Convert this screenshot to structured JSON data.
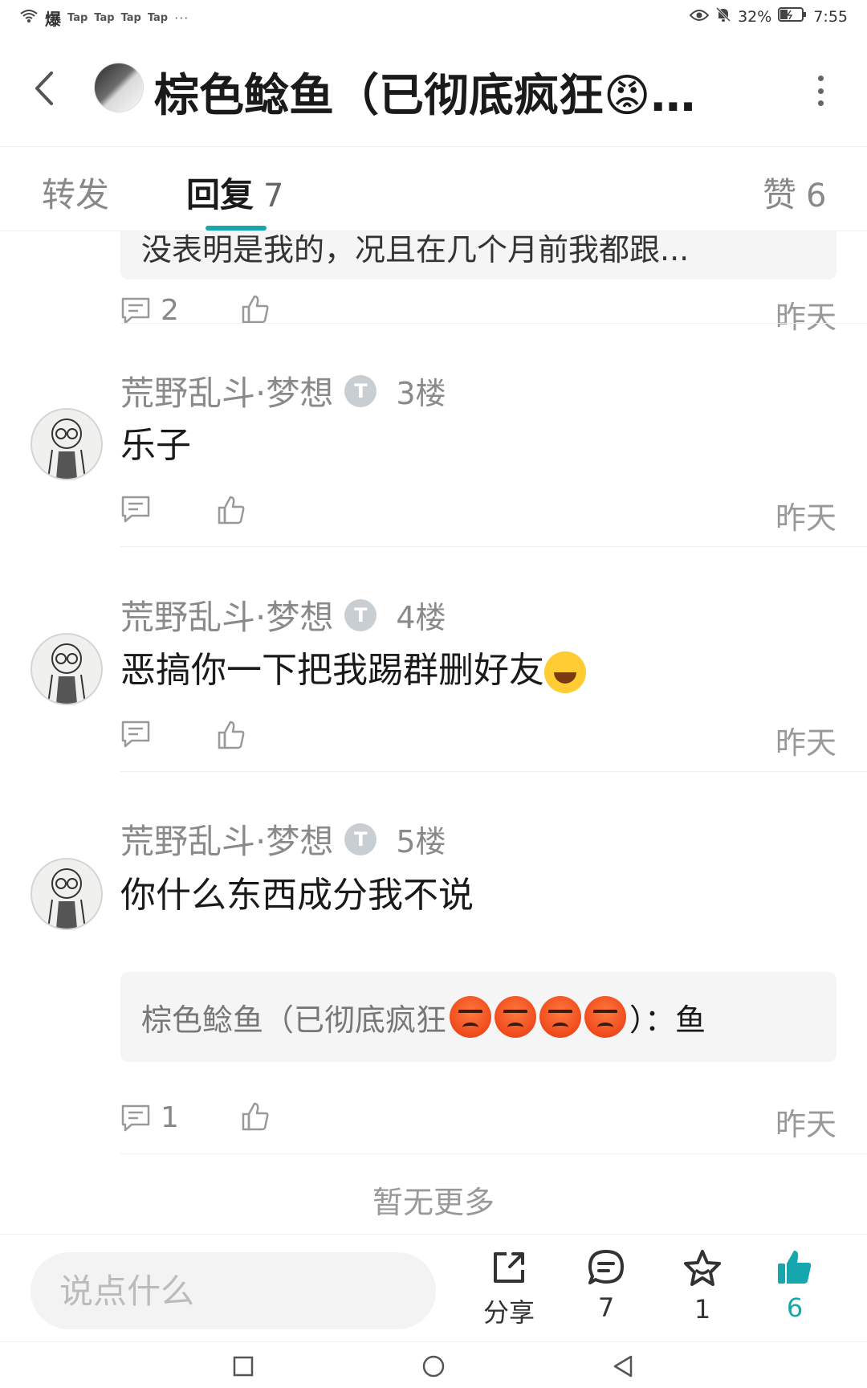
{
  "status_bar": {
    "left_glyph": "爆",
    "apps": [
      "Tap",
      "Tap",
      "Tap",
      "Tap"
    ],
    "dots": "···",
    "battery": "32%",
    "time": "7:55"
  },
  "header": {
    "title": "棕色鲶鱼（已彻底疯狂😡…"
  },
  "tabs": [
    {
      "label": "转发",
      "count": ""
    },
    {
      "label": "回复",
      "count": "7"
    },
    {
      "label": "赞",
      "count": "6"
    }
  ],
  "first_comment": {
    "quote_text": "没表明是我的，况且在几个月前我都跟...",
    "reply_count": "2",
    "time": "昨天"
  },
  "comments": [
    {
      "name": "荒野乱斗·梦想",
      "badge": "T",
      "floor": "3楼",
      "text": "乐子",
      "reply_count": "",
      "time": "昨天"
    },
    {
      "name": "荒野乱斗·梦想",
      "badge": "T",
      "floor": "4楼",
      "text": "恶搞你一下把我踢群删好友",
      "reply_count": "",
      "time": "昨天"
    },
    {
      "name": "荒野乱斗·梦想",
      "badge": "T",
      "floor": "5楼",
      "text": "你什么东西成分我不说",
      "quote_prefix": "棕色鲶鱼（已彻底疯狂",
      "quote_suffix": "）：鱼",
      "reply_count": "1",
      "time": "昨天"
    }
  ],
  "footer_text": "暂无更多",
  "bottom_bar": {
    "input_placeholder": "说点什么",
    "share_label": "分享",
    "comment_count": "7",
    "favorite_count": "1",
    "like_count": "6",
    "accent_color": "#15a7ad"
  }
}
